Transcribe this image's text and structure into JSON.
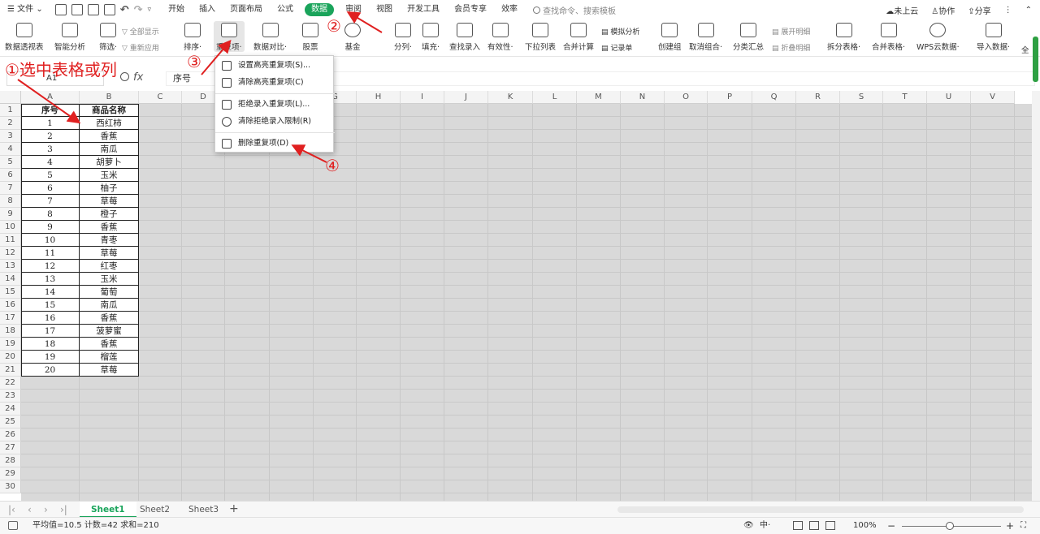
{
  "menubar": {
    "file": "文件",
    "items": [
      "开始",
      "插入",
      "页面布局",
      "公式",
      "数据",
      "审阅",
      "视图",
      "开发工具",
      "会员专享",
      "效率"
    ],
    "active": "数据",
    "search_placeholder": "查找命令、搜索模板",
    "right": [
      "未上云",
      "协作",
      "分享"
    ]
  },
  "ribbon": {
    "buttons": [
      "数据透视表",
      "智能分析",
      "筛选",
      "排序",
      "重复项",
      "数据对比",
      "股票",
      "基金",
      "分列",
      "填充",
      "查找录入",
      "有效性",
      "下拉列表",
      "合并计算",
      "创建组",
      "取消组合",
      "分类汇总",
      "拆分表格",
      "合并表格",
      "WPS云数据",
      "导入数据",
      "全"
    ],
    "small": [
      "全部显示",
      "重新应用",
      "模拟分析",
      "记录单",
      "展开明细",
      "折叠明细"
    ]
  },
  "formula": {
    "cell_ref": "A1",
    "value": "序号"
  },
  "dropdown": {
    "items": [
      "设置高亮重复项(S)...",
      "清除高亮重复项(C)",
      "拒绝录入重复项(L)...",
      "清除拒绝录入限制(R)",
      "删除重复项(D)"
    ]
  },
  "annotations": {
    "step1": "①选中表格或列",
    "step2": "②",
    "step3": "③",
    "step4": "④"
  },
  "columns": [
    "A",
    "B",
    "C",
    "D",
    "E",
    "F",
    "G",
    "H",
    "I",
    "J",
    "K",
    "L",
    "M",
    "N",
    "O",
    "P",
    "Q",
    "R",
    "S",
    "T",
    "U",
    "V"
  ],
  "rows": 30,
  "table": {
    "headers": [
      "序号",
      "商品名称"
    ],
    "rows": [
      [
        "1",
        "西红柿"
      ],
      [
        "2",
        "香蕉"
      ],
      [
        "3",
        "南瓜"
      ],
      [
        "4",
        "胡萝卜"
      ],
      [
        "5",
        "玉米"
      ],
      [
        "6",
        "柚子"
      ],
      [
        "7",
        "草莓"
      ],
      [
        "8",
        "橙子"
      ],
      [
        "9",
        "香蕉"
      ],
      [
        "10",
        "青枣"
      ],
      [
        "11",
        "草莓"
      ],
      [
        "12",
        "红枣"
      ],
      [
        "13",
        "玉米"
      ],
      [
        "14",
        "葡萄"
      ],
      [
        "15",
        "南瓜"
      ],
      [
        "16",
        "香蕉"
      ],
      [
        "17",
        "菠萝蜜"
      ],
      [
        "18",
        "香蕉"
      ],
      [
        "19",
        "榴莲"
      ],
      [
        "20",
        "草莓"
      ]
    ]
  },
  "sheets": [
    "Sheet1",
    "Sheet2",
    "Sheet3"
  ],
  "active_sheet": "Sheet1",
  "status": {
    "summary": "平均值=10.5  计数=42  求和=210",
    "zoom": "100%"
  },
  "colors": {
    "accent": "#1aa45b",
    "annotation": "#e02020"
  }
}
